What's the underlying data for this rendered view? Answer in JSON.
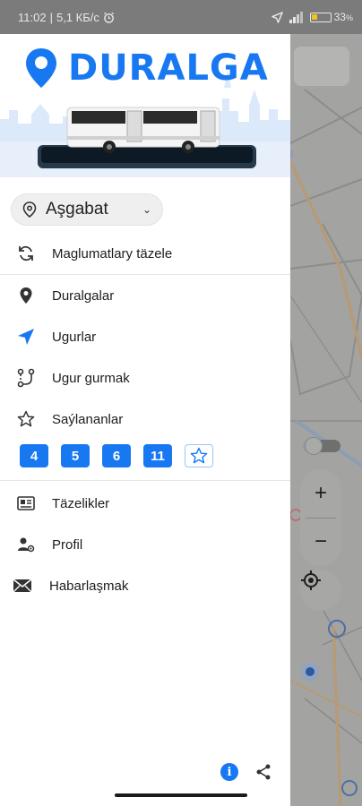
{
  "status_bar": {
    "time": "11:02",
    "speed": "5,1 КБ/с",
    "battery_level": "33",
    "battery_unit": "%"
  },
  "app": {
    "logo_text": "DURALGA",
    "brand_color": "#1778f2"
  },
  "city_selector": {
    "value": "Aşgabat",
    "icon": "location-pin-outline-icon"
  },
  "menu": {
    "refresh": {
      "label": "Maglumatlary täzele",
      "icon": "refresh-icon"
    },
    "stops": {
      "label": "Duralgalar",
      "icon": "location-pin-icon"
    },
    "routes": {
      "label": "Ugurlar",
      "icon": "navigation-arrow-icon"
    },
    "build_route": {
      "label": "Ugur gurmak",
      "icon": "route-icon"
    },
    "favorites": {
      "label": "Saýlananlar",
      "icon": "star-outline-icon"
    },
    "news": {
      "label": "Täzelikler",
      "icon": "newspaper-icon"
    },
    "profile": {
      "label": "Profil",
      "icon": "user-settings-icon"
    },
    "contact": {
      "label": "Habarlaşmak",
      "icon": "mail-icon"
    }
  },
  "favorite_routes": [
    "4",
    "5",
    "6",
    "11"
  ],
  "map_controls": {
    "zoom_in": "+",
    "zoom_out": "−"
  },
  "footer": {
    "info": "i",
    "info_icon": "info-icon",
    "share_icon": "share-icon"
  }
}
